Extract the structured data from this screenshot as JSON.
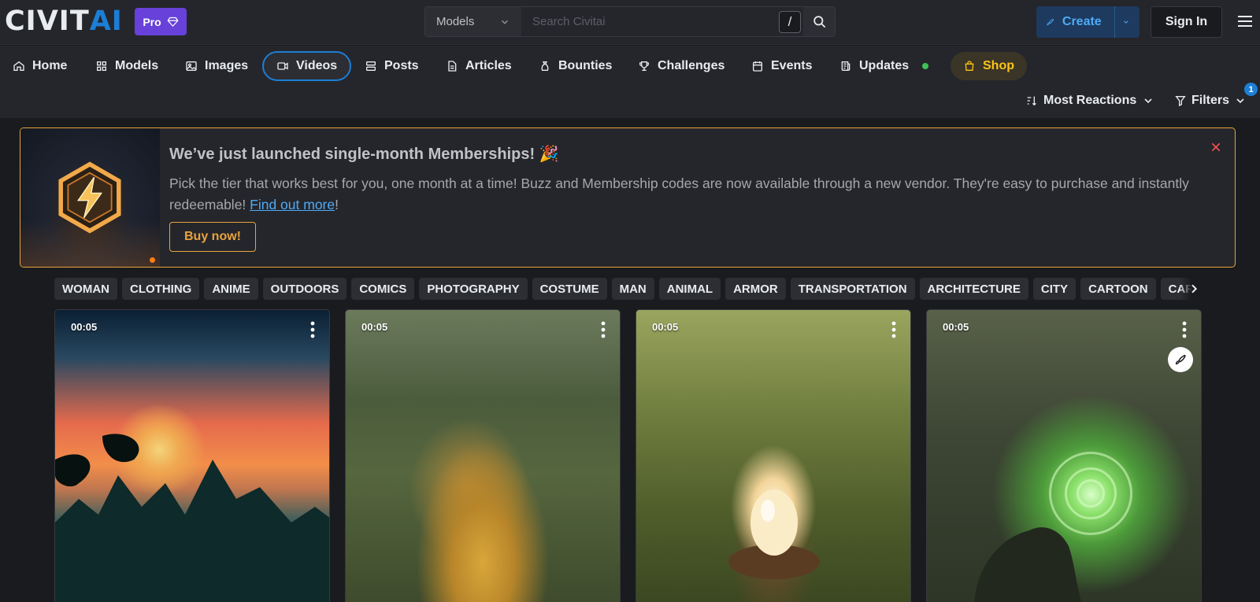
{
  "header": {
    "logo_main": "CIVIT",
    "logo_accent": "AI",
    "pro_label": "Pro",
    "search": {
      "scope": "Models",
      "placeholder": "Search Civitai",
      "shortcut": "/"
    },
    "create_label": "Create",
    "signin_label": "Sign In"
  },
  "nav": {
    "items": [
      {
        "label": "Home",
        "icon": "home-icon"
      },
      {
        "label": "Models",
        "icon": "grid-icon"
      },
      {
        "label": "Images",
        "icon": "photo-icon"
      },
      {
        "label": "Videos",
        "icon": "video-icon",
        "active": true
      },
      {
        "label": "Posts",
        "icon": "posts-icon"
      },
      {
        "label": "Articles",
        "icon": "file-icon"
      },
      {
        "label": "Bounties",
        "icon": "moneybag-icon"
      },
      {
        "label": "Challenges",
        "icon": "trophy-icon"
      },
      {
        "label": "Events",
        "icon": "calendar-icon"
      },
      {
        "label": "Updates",
        "icon": "news-icon"
      },
      {
        "label": "Shop",
        "icon": "shopping-bag-icon"
      }
    ],
    "sort_label": "Most Reactions",
    "filters_label": "Filters",
    "filters_count": "1"
  },
  "banner": {
    "title": "We’ve just launched single-month Memberships! 🎉",
    "text_before": "Pick the tier that works best for you, one month at a time! Buzz and Membership codes are now available through a new vendor. They're easy to purchase and instantly redeemable! ",
    "link_label": "Find out more",
    "text_after": "!",
    "button_label": "Buy now!"
  },
  "tags": [
    "WOMAN",
    "CLOTHING",
    "ANIME",
    "OUTDOORS",
    "COMICS",
    "PHOTOGRAPHY",
    "COSTUME",
    "MAN",
    "ANIMAL",
    "ARMOR",
    "TRANSPORTATION",
    "ARCHITECTURE",
    "CITY",
    "CARTOON",
    "CAR"
  ],
  "cards": [
    {
      "duration": "00:05"
    },
    {
      "duration": "00:05"
    },
    {
      "duration": "00:05"
    },
    {
      "duration": "00:05"
    }
  ],
  "colors": {
    "accent": "#1c7ed6",
    "pro": "#6741d9",
    "banner_border": "#e8a33d",
    "shop": "#fcc419",
    "online": "#40c057"
  }
}
